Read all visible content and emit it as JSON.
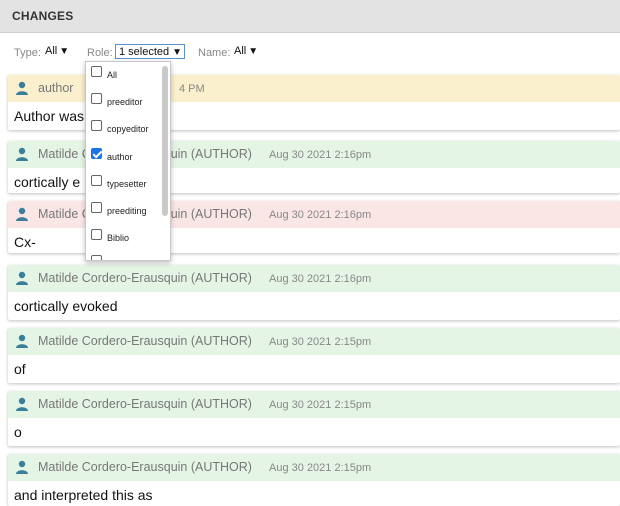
{
  "header": {
    "title": "CHANGES"
  },
  "filters": {
    "type_label": "Type:",
    "type_value": "All",
    "role_label": "Role:",
    "role_value": "1 selected",
    "name_label": "Name:",
    "name_value": "All",
    "arrow": "▼"
  },
  "role_dropdown": {
    "options": [
      {
        "label": "All",
        "checked": false
      },
      {
        "label": "preeditor",
        "checked": false
      },
      {
        "label": "copyeditor",
        "checked": false
      },
      {
        "label": "author",
        "checked": true
      },
      {
        "label": "typesetter",
        "checked": false
      },
      {
        "label": "preediting",
        "checked": false
      },
      {
        "label": "Biblio",
        "checked": false
      }
    ]
  },
  "changes": [
    {
      "author": "author",
      "date": "4 PM",
      "text": "Author was",
      "status": "modified"
    },
    {
      "author": "Matilde Cordero-Erausquin (AUTHOR)",
      "date": "Aug 30 2021 2:16pm",
      "text": "cortically e",
      "status": "insert"
    },
    {
      "author": "Matilde Cordero-Erausquin (AUTHOR)",
      "date": "Aug 30 2021 2:16pm",
      "text": "Cx-",
      "status": "delete"
    },
    {
      "author": "Matilde Cordero-Erausquin (AUTHOR)",
      "date": "Aug 30 2021 2:16pm",
      "text": "cortically evoked",
      "status": "insert"
    },
    {
      "author": "Matilde Cordero-Erausquin (AUTHOR)",
      "date": "Aug 30 2021 2:15pm",
      "text": "of",
      "status": "insert"
    },
    {
      "author": "Matilde Cordero-Erausquin (AUTHOR)",
      "date": "Aug 30 2021 2:15pm",
      "text": "o",
      "status": "insert"
    },
    {
      "author": "Matilde Cordero-Erausquin (AUTHOR)",
      "date": "Aug 30 2021 2:15pm",
      "text": "and interpreted this as",
      "status": "insert"
    }
  ],
  "colors": {
    "insert_bg": "#e5f5e5",
    "delete_bg": "#fbe6e6",
    "modified_bg": "#fbf0cd",
    "icon": "#3a7f9a"
  },
  "icons": {
    "user": "user-icon",
    "checkbox": "checkbox-icon"
  }
}
